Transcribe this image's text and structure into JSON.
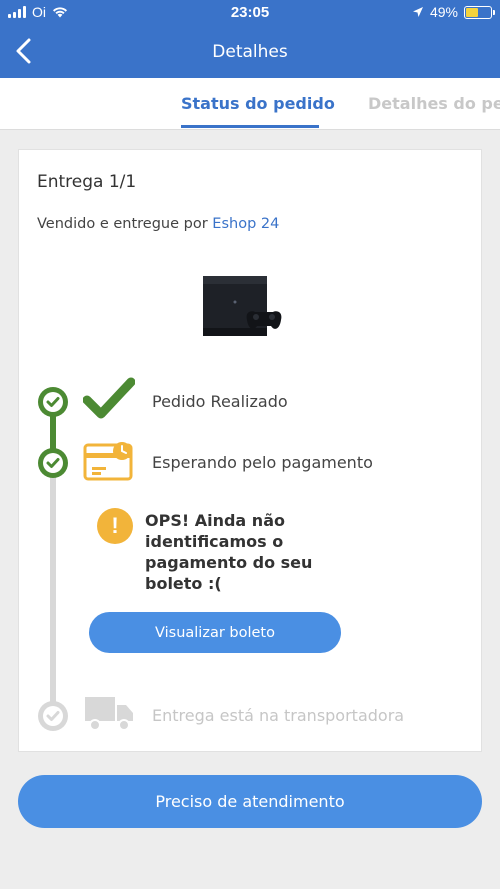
{
  "status_bar": {
    "carrier": "Oi",
    "time": "23:05",
    "battery": "49%"
  },
  "header": {
    "title": "Detalhes",
    "back_icon": "chevron-left-icon"
  },
  "tabs": [
    {
      "label": "Status do pedido",
      "active": true
    },
    {
      "label": "Detalhes do ped",
      "active": false
    }
  ],
  "delivery": {
    "title": "Entrega 1/1",
    "seller_prefix": "Vendido e entregue por",
    "seller_name": "Eshop 24"
  },
  "timeline": {
    "steps": [
      {
        "label": "Pedido Realizado",
        "state": "done",
        "icon": "checkmark-icon"
      },
      {
        "label": "Esperando pelo pagamento",
        "state": "done",
        "icon": "payment-card-icon"
      },
      {
        "label": "Entrega está na transportadora",
        "state": "pending",
        "icon": "truck-icon"
      }
    ],
    "warning": {
      "text": "OPS! Ainda não identificamos o pagamento do seu boleto :(",
      "icon": "exclamation-icon"
    },
    "view_button": "Visualizar boleto"
  },
  "help_button": "Preciso de atendimento",
  "colors": {
    "primary": "#3a73c9",
    "button": "#4a8fe3",
    "success": "#4c8a33",
    "warning": "#f2b43a",
    "muted": "#d8d8d8"
  }
}
